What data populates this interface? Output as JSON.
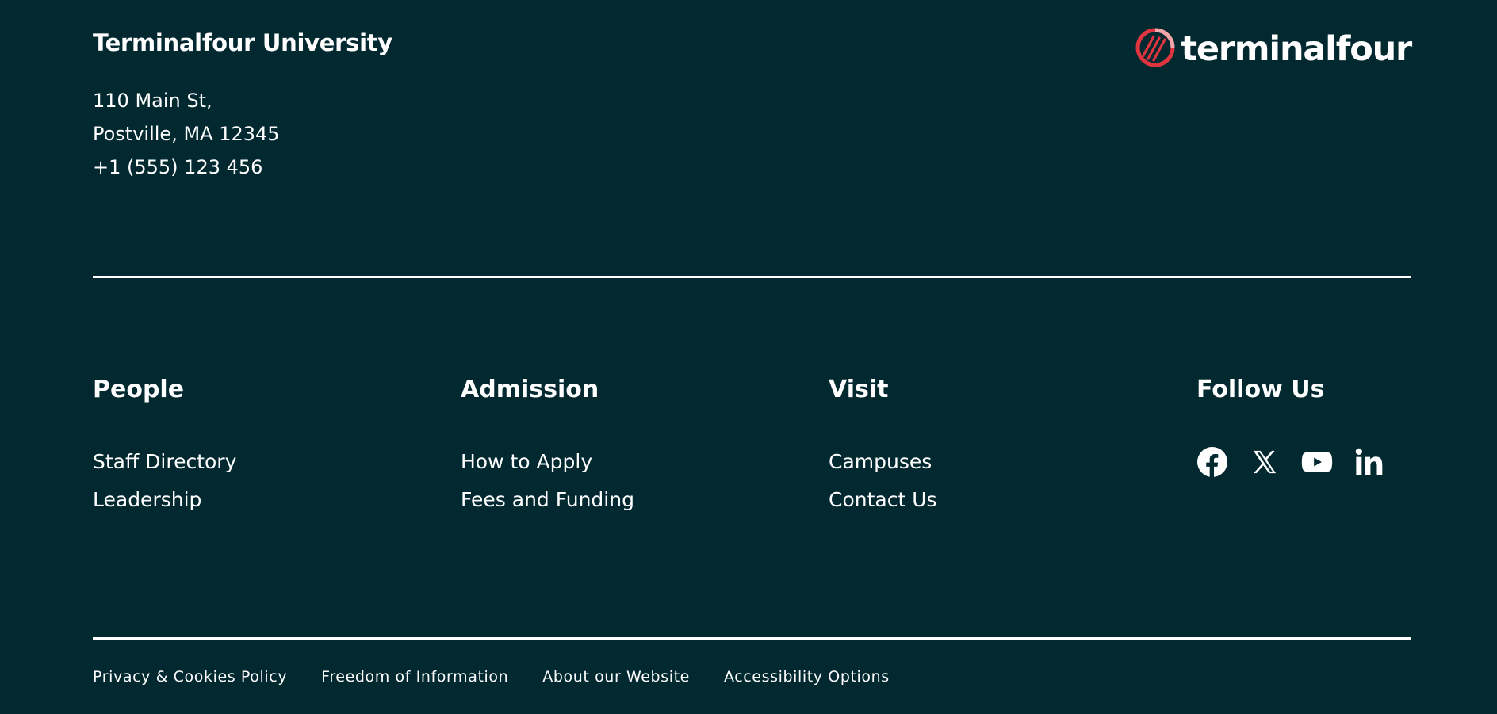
{
  "colors": {
    "background": "#022830",
    "text": "#ffffff",
    "logo_accent": "#e0353f",
    "logo_accent_light": "#f0a7aa"
  },
  "institution": {
    "name": "Terminalfour University",
    "address_line_1": "110 Main St,",
    "address_line_2": "Postville, MA 12345",
    "phone": "+1 (555) 123 456"
  },
  "logo": {
    "text": "terminalfour",
    "icon": "terminalfour-logo-icon"
  },
  "columns": [
    {
      "title": "People",
      "links": [
        "Staff Directory",
        "Leadership"
      ]
    },
    {
      "title": "Admission",
      "links": [
        "How to Apply",
        "Fees and Funding"
      ]
    },
    {
      "title": "Visit",
      "links": [
        "Campuses",
        "Contact Us"
      ]
    }
  ],
  "follow": {
    "title": "Follow Us",
    "icons": [
      "facebook-icon",
      "x-icon",
      "youtube-icon",
      "linkedin-icon"
    ]
  },
  "legal_links": [
    "Privacy & Cookies Policy",
    "Freedom of Information",
    "About our Website",
    "Accessibility Options"
  ]
}
